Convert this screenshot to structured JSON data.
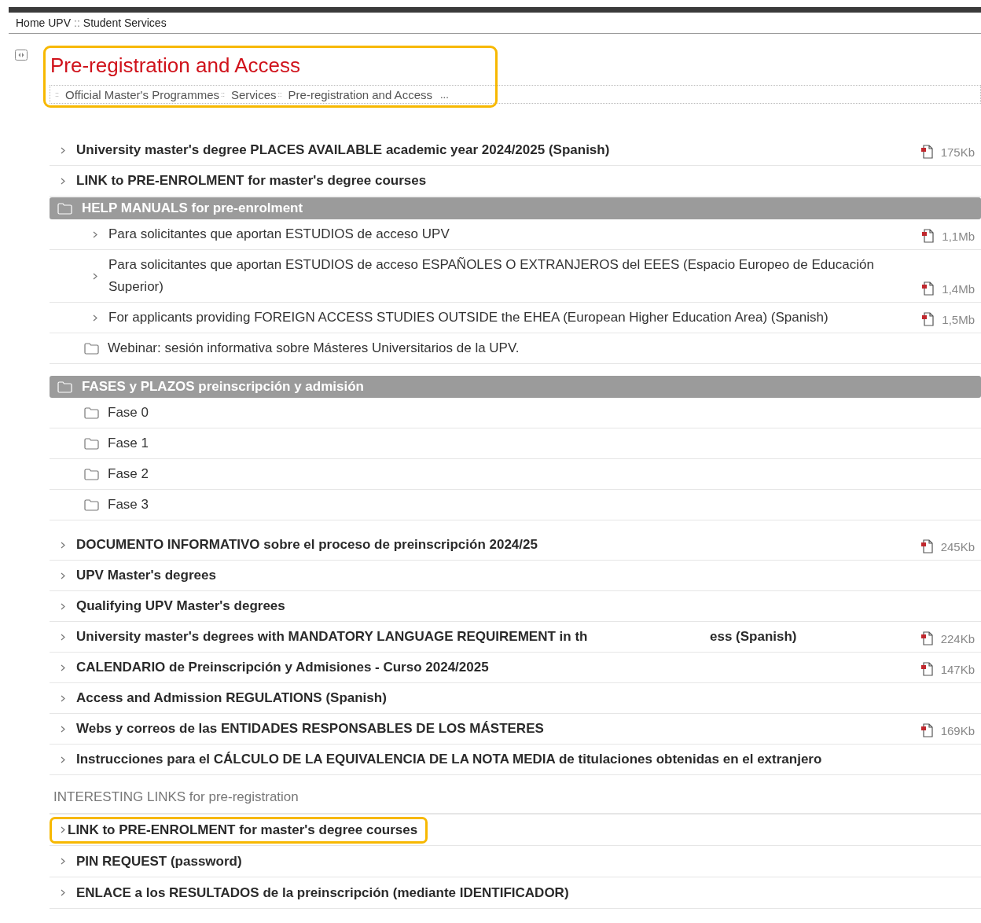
{
  "breadcrumb": {
    "items": [
      "Home UPV",
      "Student Services"
    ],
    "separator": "::"
  },
  "title": {
    "text": "Pre-registration and Access",
    "highlighted": true
  },
  "path": {
    "items": [
      "Official Master's Programmes",
      "Services",
      "Pre-registration and Access"
    ],
    "separator": "::",
    "more": "..."
  },
  "items": [
    {
      "kind": "link",
      "text": "University master's degree PLACES AVAILABLE academic year 2024/2025 (Spanish)",
      "size": "175Kb"
    },
    {
      "kind": "link",
      "text": "LINK to PRE-ENROLMENT for master's degree courses"
    },
    {
      "kind": "folder",
      "text": "HELP MANUALS for pre-enrolment",
      "children": [
        {
          "kind": "link",
          "text": "Para solicitantes que aportan ESTUDIOS de acceso UPV",
          "size": "1,1Mb"
        },
        {
          "kind": "link",
          "text": "Para solicitantes que aportan ESTUDIOS de acceso ESPAÑOLES O EXTRANJEROS del EEES (Espacio Europeo de Educación Superior)",
          "size": "1,4Mb"
        },
        {
          "kind": "link",
          "text": "For applicants providing FOREIGN ACCESS STUDIES OUTSIDE the EHEA (European Higher Education Area) (Spanish)",
          "size": "1,5Mb"
        },
        {
          "kind": "folder",
          "text": "Webinar: sesión informativa sobre Másteres Universitarios de la UPV."
        }
      ]
    },
    {
      "kind": "folder",
      "text": "FASES y PLAZOS preinscripción y admisión",
      "children": [
        {
          "kind": "folder",
          "text": "Fase 0"
        },
        {
          "kind": "folder",
          "text": "Fase 1"
        },
        {
          "kind": "folder",
          "text": "Fase 2"
        },
        {
          "kind": "folder",
          "text": "Fase 3"
        }
      ]
    },
    {
      "kind": "link",
      "text": "DOCUMENTO INFORMATIVO sobre el proceso de preinscripción 2024/25",
      "size": "245Kb"
    },
    {
      "kind": "link",
      "text": "UPV Master's degrees"
    },
    {
      "kind": "link",
      "text": "Qualifying UPV Master's degrees"
    },
    {
      "kind": "link",
      "text": "University master's degrees with MANDATORY LANGUAGE REQUIREMENT in th",
      "tail": "ess (Spanish)",
      "size": "224Kb"
    },
    {
      "kind": "link",
      "text": "CALENDARIO de Preinscripción y Admisiones - Curso 2024/2025",
      "size": "147Kb"
    },
    {
      "kind": "link",
      "text": "Access and Admission REGULATIONS (Spanish)"
    },
    {
      "kind": "link",
      "text": "Webs y correos de las ENTIDADES RESPONSABLES DE LOS MÁSTERES",
      "size": "169Kb"
    },
    {
      "kind": "link",
      "text": "Instrucciones para el CÁLCULO DE LA EQUIVALENCIA DE LA NOTA MEDIA de titulaciones obtenidas en el extranjero"
    }
  ],
  "links_heading": "INTERESTING LINKS for pre-registration",
  "links": [
    {
      "text": "LINK to PRE-ENROLMENT for master's degree courses",
      "highlighted": true
    },
    {
      "text": "PIN REQUEST (password)",
      "highlighted": false
    },
    {
      "text": "ENLACE a los RESULTADOS de la preinscripción (mediante IDENTIFICADOR)",
      "highlighted": false
    }
  ]
}
